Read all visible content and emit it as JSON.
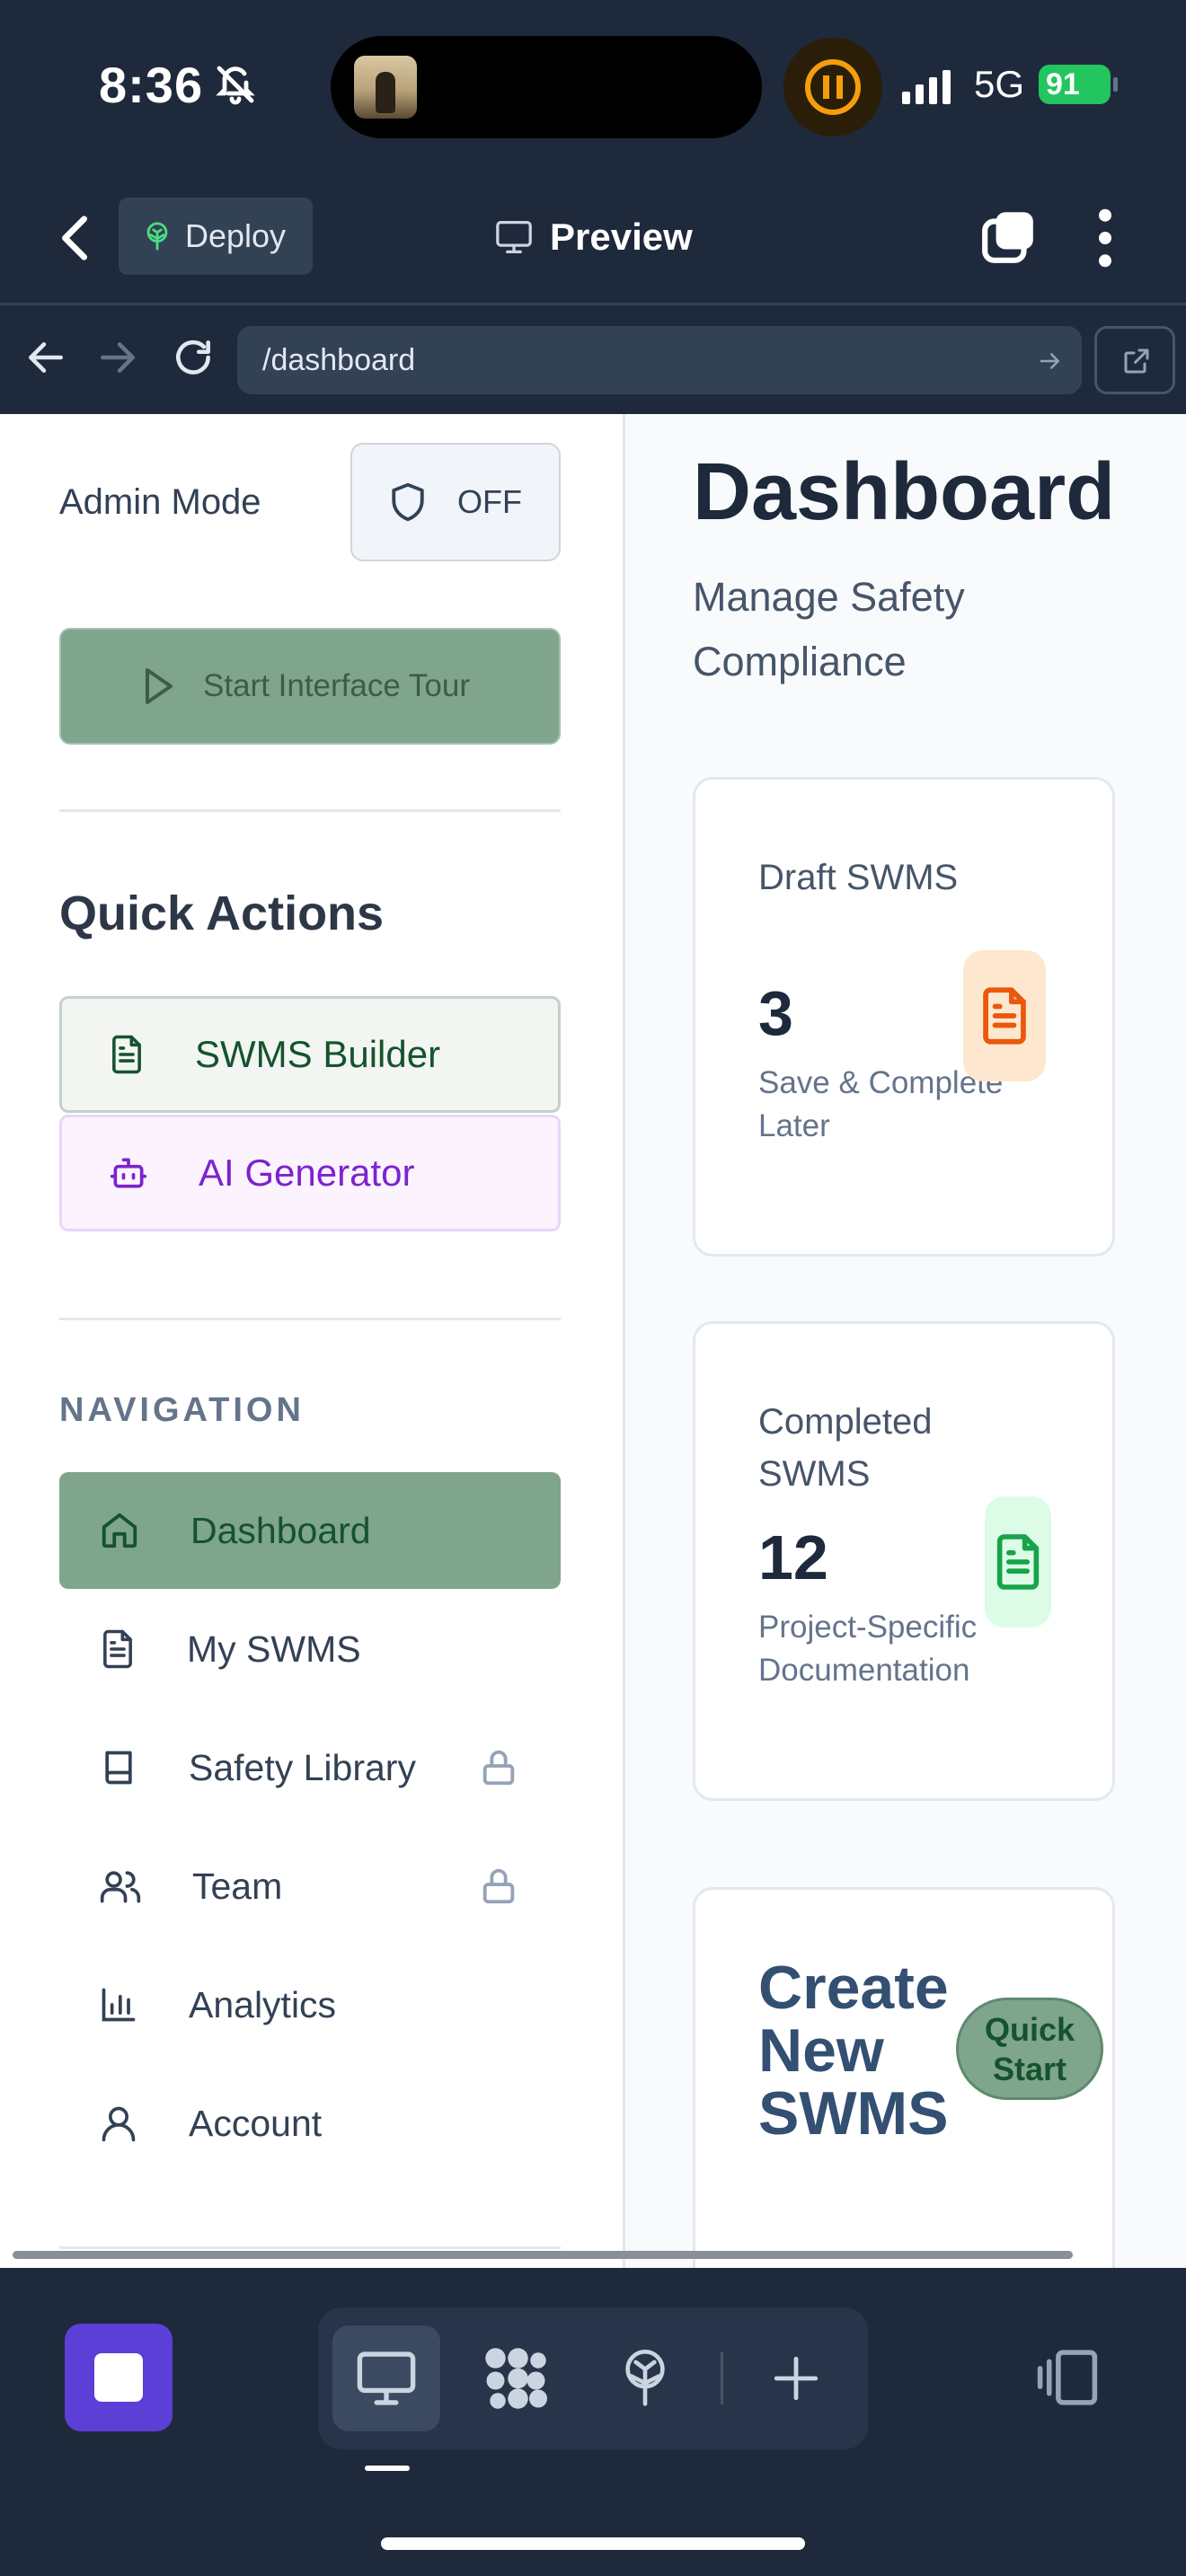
{
  "status_bar": {
    "time": "8:36",
    "network": "5G",
    "battery": "91"
  },
  "toolbar": {
    "deploy_label": "Deploy",
    "preview_label": "Preview"
  },
  "address_bar": {
    "url": "/dashboard"
  },
  "sidebar": {
    "admin_mode_label": "Admin Mode",
    "admin_toggle_state": "OFF",
    "tour_button_label": "Start Interface Tour",
    "quick_actions_title": "Quick Actions",
    "quick_actions": [
      {
        "label": "SWMS Builder",
        "icon": "file-text-icon"
      },
      {
        "label": "AI Generator",
        "icon": "bot-icon"
      }
    ],
    "navigation_title": "NAVIGATION",
    "nav_items": [
      {
        "label": "Dashboard",
        "icon": "home-icon",
        "active": true,
        "locked": false
      },
      {
        "label": "My SWMS",
        "icon": "file-text-icon",
        "active": false,
        "locked": false
      },
      {
        "label": "Safety Library",
        "icon": "book-icon",
        "active": false,
        "locked": true
      },
      {
        "label": "Team",
        "icon": "users-icon",
        "active": false,
        "locked": true
      },
      {
        "label": "Analytics",
        "icon": "bar-chart-icon",
        "active": false,
        "locked": false
      },
      {
        "label": "Account",
        "icon": "user-icon",
        "active": false,
        "locked": false
      }
    ]
  },
  "main": {
    "title": "Dashboard",
    "subtitle": "Manage Safety Compliance",
    "cards": [
      {
        "label": "Draft SWMS",
        "value": "3",
        "description": "Save & Complete Later",
        "icon": "file-text-icon",
        "accent": "#ea580c"
      },
      {
        "label": "Completed SWMS",
        "value": "12",
        "description": "Project-Specific Documentation",
        "icon": "file-text-icon",
        "accent": "#16a34a"
      }
    ],
    "create_card": {
      "title": "Create New SWMS",
      "badge": "Quick Start"
    }
  },
  "colors": {
    "sage": "#7fa58d",
    "navy": "#1e293b",
    "purple": "#7e22ce",
    "app_purple": "#5b3fd6"
  },
  "dock": {
    "items": [
      "desktop-icon",
      "shapes-icon",
      "deploy-icon",
      "plus-icon"
    ],
    "selected": "desktop-icon"
  }
}
